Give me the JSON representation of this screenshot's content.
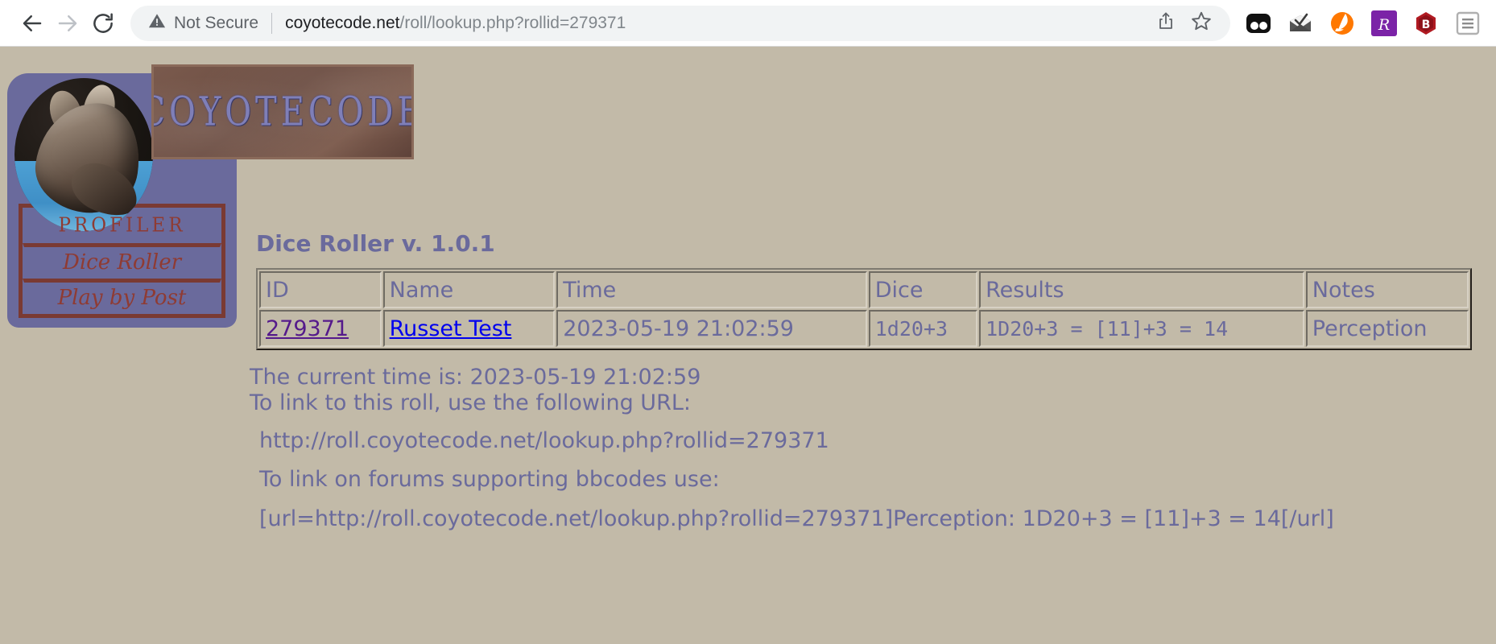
{
  "browser": {
    "back_icon": "back-arrow-icon",
    "forward_icon": "forward-arrow-icon",
    "reload_icon": "reload-icon",
    "security_label": "Not Secure",
    "security_icon": "warning-triangle-icon",
    "url_host": "coyotecode.net",
    "url_path": "/roll/lookup.php?rollid=279371",
    "url_full": "coyotecode.net/roll/lookup.php?rollid=279371",
    "share_icon": "share-upload-icon",
    "bookmark_icon": "star-icon",
    "extensions": [
      {
        "name": "flickr-extension-icon",
        "label": ""
      },
      {
        "name": "mail-checker-extension-icon",
        "label": ""
      },
      {
        "name": "avast-extension-icon",
        "label": ""
      },
      {
        "name": "rakuten-extension-icon",
        "label": ""
      },
      {
        "name": "bitdefender-extension-icon",
        "label": ""
      },
      {
        "name": "browser-menu-icon",
        "label": ""
      }
    ]
  },
  "site": {
    "logo_wordmark": "COYOTECODE",
    "logo_photo": "coyote-photo",
    "nav": [
      {
        "id": "profiler",
        "label": "PROFILER"
      },
      {
        "id": "dice-roller",
        "label": "Dice Roller"
      },
      {
        "id": "play-by-post",
        "label": "Play by Post"
      }
    ]
  },
  "main": {
    "title": "Dice Roller v. 1.0.1",
    "table": {
      "headers": [
        "ID",
        "Name",
        "Time",
        "Dice",
        "Results",
        "Notes"
      ],
      "rows": [
        {
          "id": "279371",
          "name": "Russet Test",
          "time": "2023-05-19 21:02:59",
          "dice": "1d20+3",
          "results": "1D20+3 = [11]+3 = 14",
          "notes": "Perception"
        }
      ]
    },
    "current_time_line": "The current time is: 2023-05-19 21:02:59",
    "url_intro_line": "To link to this roll, use the following URL:",
    "roll_url": "http://roll.coyotecode.net/lookup.php?rollid=279371",
    "bbcode_intro_line": "To link on forums supporting bbcodes use:",
    "bbcode_text": "[url=http://roll.coyotecode.net/lookup.php?rollid=279371]Perception: 1D20+3 = [11]+3 = 14[/url]"
  },
  "colors": {
    "page_background": "#c2baa8",
    "panel_purple": "#6a6a9c",
    "accent_rust": "#8f3b33",
    "text_purple": "#6a6a9c",
    "link_visited": "#551a8b",
    "link_unvisited": "#0000ee"
  }
}
